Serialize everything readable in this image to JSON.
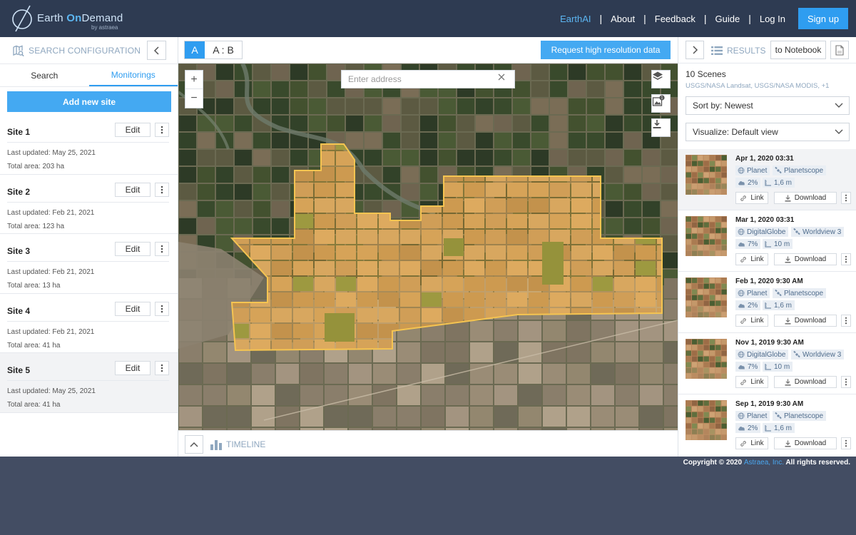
{
  "header": {
    "brand": {
      "first": "Earth",
      "accent": "On",
      "last": "Demand",
      "by": "by astraea"
    },
    "nav": [
      "EarthAI",
      "About",
      "Feedback",
      "Guide",
      "Log In"
    ],
    "signup": "Sign up",
    "colors": {
      "bar": "#2e3b52",
      "accent": "#2f9df0"
    }
  },
  "left_panel": {
    "title": "SEARCH CONFIGURATION",
    "tabs": [
      "Search",
      "Monitorings"
    ],
    "active_tab": "Monitorings",
    "add_site": "Add new site",
    "edit_label": "Edit",
    "sites": [
      {
        "name": "Site 1",
        "updated": "Last updated: May 25, 2021",
        "area": "Total area: 203 ha"
      },
      {
        "name": "Site 2",
        "updated": "Last updated: Feb 21, 2021",
        "area": "Total area: 123 ha"
      },
      {
        "name": "Site 3",
        "updated": "Last updated: Feb 21, 2021",
        "area": "Total area: 13 ha"
      },
      {
        "name": "Site 4",
        "updated": "Last updated: Feb 21, 2021",
        "area": "Total area: 41 ha"
      },
      {
        "name": "Site 5",
        "updated": "Last updated: May 25, 2021",
        "area": "Total area: 41 ha"
      }
    ]
  },
  "map": {
    "mode_a": "A",
    "mode_ab": "A : B",
    "request_button": "Request high resolution data",
    "search_placeholder": "Enter address",
    "zoom_in": "+",
    "zoom_out": "−",
    "tool_icons": [
      "layers-icon",
      "image-badge-icon",
      "download-icon"
    ],
    "timeline_label": "TIMELINE",
    "polygon_color": "#f0b34a"
  },
  "results": {
    "title": "RESULTS",
    "notebook": "to Notebook",
    "count": "10 Scenes",
    "sources": "USGS/NASA Landsat, USGS/NASA MODIS, +1",
    "sort": "Sort by: Newest",
    "visualize": "Visualize: Default view",
    "link_label": "Link",
    "download_label": "Download",
    "scenes": [
      {
        "date": "Apr 1, 2020 03:31",
        "provider": "Planet",
        "sensor": "Planetscope",
        "cloud": "2%",
        "res": "1,6 m"
      },
      {
        "date": "Mar 1, 2020 03:31",
        "provider": "DigitalGlobe",
        "sensor": "Worldview 3",
        "cloud": "7%",
        "res": "10 m"
      },
      {
        "date": "Feb 1, 2020 9:30 AM",
        "provider": "Planet",
        "sensor": "Planetscope",
        "cloud": "2%",
        "res": "1,6 m"
      },
      {
        "date": "Nov 1, 2019 9:30 AM",
        "provider": "DigitalGlobe",
        "sensor": "Worldview 3",
        "cloud": "7%",
        "res": "10 m"
      },
      {
        "date": "Sep 1, 2019 9:30 AM",
        "provider": "Planet",
        "sensor": "Planetscope",
        "cloud": "2%",
        "res": "1,6 m"
      }
    ]
  },
  "footer": {
    "copyright_pre": "Copyright © 2020",
    "copyright_link": "Astraea, Inc.",
    "copyright_post": "All rights reserved."
  }
}
